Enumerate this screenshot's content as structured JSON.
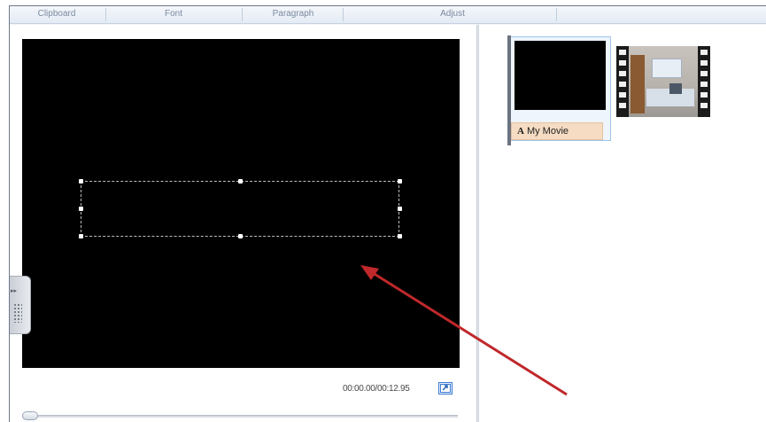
{
  "ribbon": {
    "groups": [
      "Clipboard",
      "Font",
      "Paragraph",
      "Adjust"
    ]
  },
  "preview": {
    "time_readout": "00:00.00/00:12.95",
    "fullscreen_icon": "expand-icon",
    "side_toggle_glyph": "▸▸"
  },
  "storyboard": {
    "title_clip_caption": "My Movie",
    "title_clip_icon": "A"
  },
  "annotation": {
    "arrow_color": "#c0282b"
  }
}
